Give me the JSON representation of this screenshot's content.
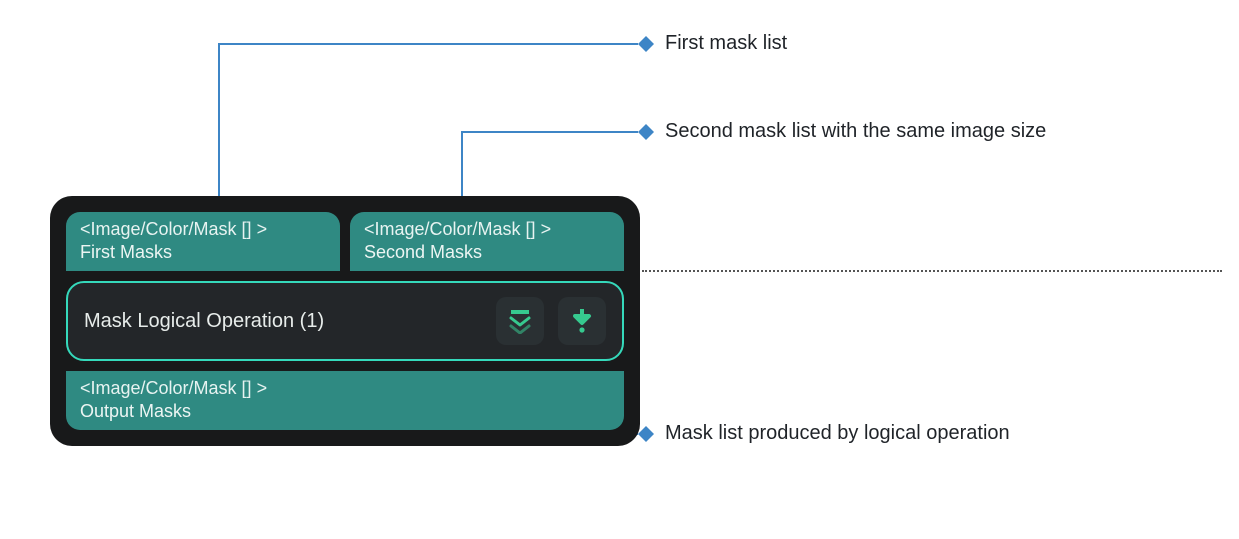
{
  "annotations": {
    "first_mask_list": "First mask list",
    "second_mask_list": "Second mask list with the same image size",
    "output_mask_list": "Mask list produced by logical operation"
  },
  "node": {
    "title": "Mask Logical Operation (1)",
    "inputs": {
      "first": {
        "type": "<Image/Color/Mask [] >",
        "name": "First Masks"
      },
      "second": {
        "type": "<Image/Color/Mask [] >",
        "name": "Second Masks"
      }
    },
    "outputs": {
      "out": {
        "type": "<Image/Color/Mask [] >",
        "name": "Output Masks"
      }
    },
    "icons": {
      "expand": "expand-down-icon",
      "exec": "exec-arrow-icon"
    }
  },
  "colors": {
    "panel_bg": "#18191a",
    "port_bg": "#2f8a82",
    "body_bg": "#232629",
    "body_border": "#35d9bb",
    "icon_green": "#36c98f",
    "connector": "#3d85c6"
  }
}
